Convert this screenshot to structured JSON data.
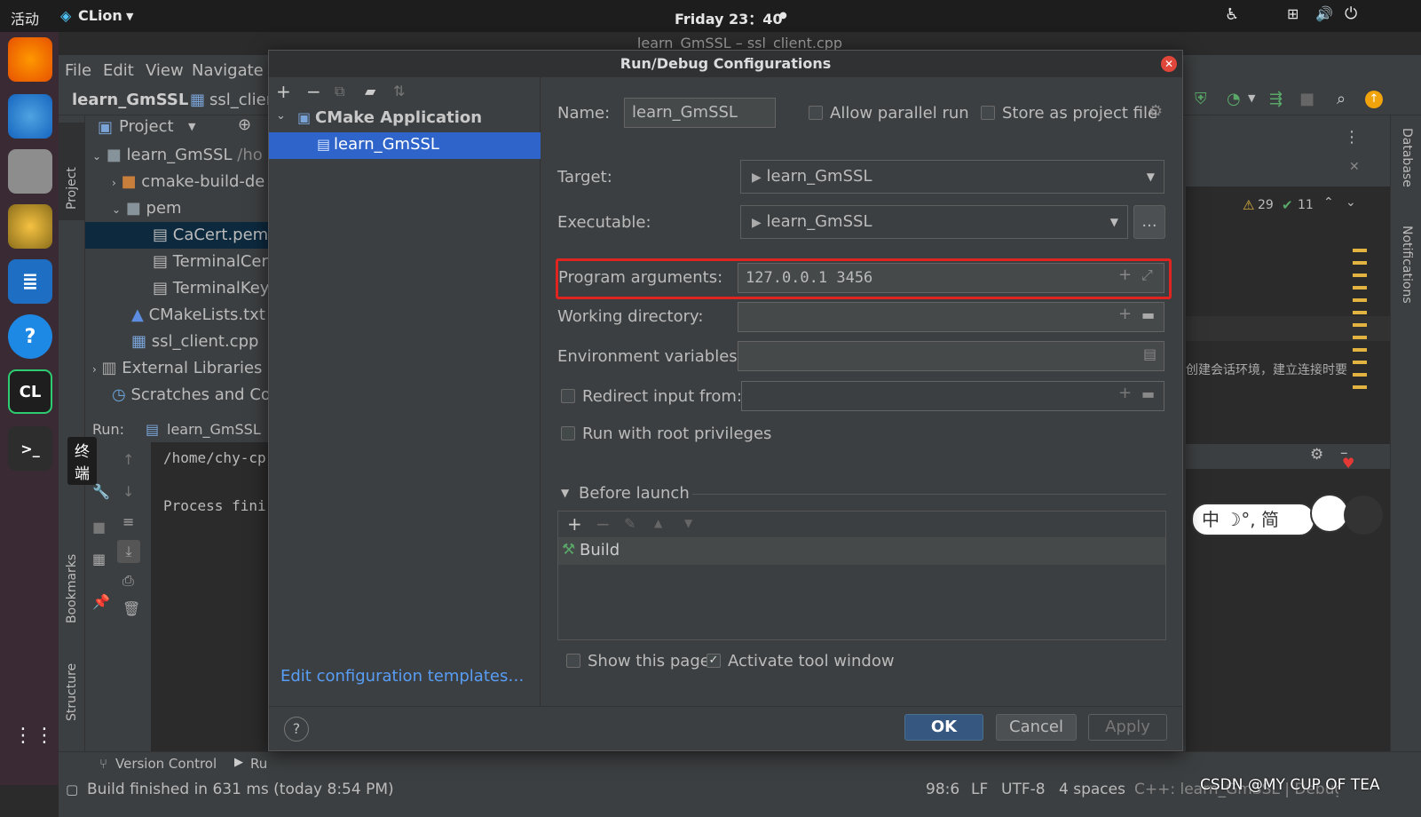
{
  "topbar": {
    "activities": "活动",
    "app_name": "CLion",
    "clock": "Friday 23：40"
  },
  "dock": {
    "tooltip": "终端",
    "clion_badge": "CL"
  },
  "window": {
    "title": "learn_GmSSL – ssl_client.cpp"
  },
  "menu": {
    "items": [
      "File",
      "Edit",
      "View",
      "Navigate"
    ]
  },
  "breadcrumb": {
    "project": "learn_GmSSL",
    "file": "ssl_clier"
  },
  "project_panel": {
    "header": "Project",
    "tree": [
      {
        "label": "learn_GmSSL",
        "suffix": "/ho"
      },
      {
        "label": "cmake-build-de"
      },
      {
        "label": "pem"
      },
      {
        "label": "CaCert.pem"
      },
      {
        "label": "TerminalCert"
      },
      {
        "label": "TerminalKey"
      },
      {
        "label": "CMakeLists.txt"
      },
      {
        "label": "ssl_client.cpp"
      },
      {
        "label": "External Libraries"
      },
      {
        "label": "Scratches and Con"
      }
    ]
  },
  "run_panel": {
    "label": "Run:",
    "config": "learn_GmSSL",
    "lines": [
      "/home/chy-cp",
      "Process fini"
    ]
  },
  "side_tabs": {
    "project": "Project",
    "bookmarks": "Bookmarks",
    "structure": "Structure",
    "database": "Database",
    "notifications": "Notifications"
  },
  "editor": {
    "warnings": "29",
    "checks": "11",
    "chinese_text": "创建会话环境，建立连接时要",
    "ime": "中 ☽°, 简"
  },
  "bottom_tabs": {
    "version_control": "Version Control",
    "run": "Ru"
  },
  "status": {
    "message": "Build finished in 631 ms (today 8:54 PM)",
    "position": "98:6",
    "line_sep": "LF",
    "encoding": "UTF-8",
    "indent": "4 spaces",
    "context": "C++: learn_GmSSL | Debug",
    "watermark": "CSDN @MY CUP OF TEA"
  },
  "dialog": {
    "title": "Run/Debug Configurations",
    "tree_group": "CMake Application",
    "tree_item": "learn_GmSSL",
    "edit_templates": "Edit configuration templates…",
    "name_label": "Name:",
    "name_value": "learn_GmSSL",
    "allow_parallel": "Allow parallel run",
    "store_project": "Store as project file",
    "target_label": "Target:",
    "target_value": "learn_GmSSL",
    "executable_label": "Executable:",
    "executable_value": "learn_GmSSL",
    "ellipsis": "...",
    "program_args_label": "Program arguments:",
    "program_args_value": "127.0.0.1 3456",
    "working_dir_label": "Working directory:",
    "env_label": "Environment variables:",
    "redirect_label": "Redirect input from:",
    "root_label": "Run with root privileges",
    "before_launch": "Before launch",
    "build_task": "Build",
    "show_page": "Show this page",
    "activate_tool": "Activate tool window",
    "help": "?",
    "ok": "OK",
    "cancel": "Cancel",
    "apply": "Apply"
  },
  "colors": {
    "accent": "#2f65ca",
    "highlight_border": "#e0241f",
    "link": "#589df6"
  }
}
